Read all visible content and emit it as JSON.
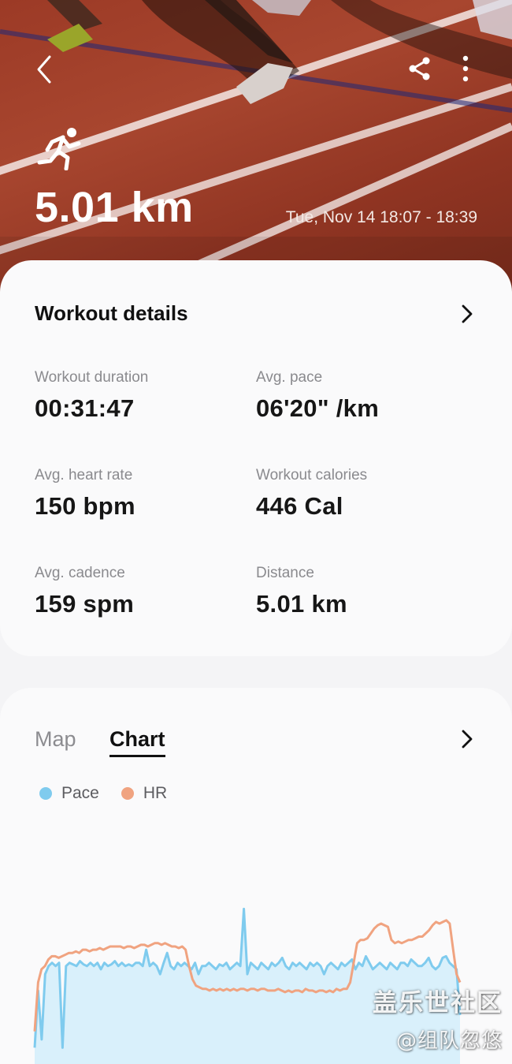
{
  "header": {
    "distance": "5.01 km",
    "datetime": "Tue, Nov 14 18:07 - 18:39"
  },
  "details": {
    "title": "Workout details",
    "metrics": [
      {
        "label": "Workout duration",
        "value": "00:31:47"
      },
      {
        "label": "Avg. pace",
        "value": "06'20\" /km"
      },
      {
        "label": "Avg. heart rate",
        "value": "150 bpm"
      },
      {
        "label": "Workout calories",
        "value": "446 Cal"
      },
      {
        "label": "Avg. cadence",
        "value": "159 spm"
      },
      {
        "label": "Distance",
        "value": "5.01 km"
      }
    ]
  },
  "chart_section": {
    "tabs": [
      "Map",
      "Chart"
    ],
    "active_tab": "Chart"
  },
  "icons": {
    "back": "back-arrow-icon",
    "share": "share-icon",
    "more": "more-vertical-icon",
    "activity": "running-icon",
    "chevron": "chevron-right-icon"
  },
  "colors": {
    "pace": "#7fcbee",
    "hr": "#f0a380",
    "pace_fill": "#d9f0fb"
  },
  "watermark": {
    "line1": "盖乐世社区",
    "line2": "@组队忽悠"
  },
  "chart_data": {
    "type": "line",
    "xlabel": "",
    "ylabel": "",
    "series": [
      {
        "name": "Pace",
        "values": [
          0.1,
          0.45,
          0.15,
          0.55,
          0.6,
          0.62,
          0.6,
          0.62,
          0.1,
          0.6,
          0.62,
          0.61,
          0.6,
          0.63,
          0.61,
          0.6,
          0.62,
          0.6,
          0.62,
          0.58,
          0.62,
          0.6,
          0.61,
          0.63,
          0.6,
          0.62,
          0.6,
          0.61,
          0.6,
          0.62,
          0.62,
          0.6,
          0.7,
          0.6,
          0.62,
          0.6,
          0.55,
          0.62,
          0.68,
          0.6,
          0.58,
          0.62,
          0.6,
          0.62,
          0.6,
          0.58,
          0.62,
          0.55,
          0.6,
          0.6,
          0.62,
          0.6,
          0.58,
          0.61,
          0.6,
          0.62,
          0.58,
          0.6,
          0.62,
          0.6,
          0.95,
          0.55,
          0.62,
          0.6,
          0.58,
          0.62,
          0.6,
          0.58,
          0.62,
          0.6,
          0.62,
          0.65,
          0.6,
          0.58,
          0.62,
          0.6,
          0.62,
          0.6,
          0.58,
          0.62,
          0.6,
          0.62,
          0.6,
          0.55,
          0.6,
          0.62,
          0.6,
          0.58,
          0.62,
          0.6,
          0.62,
          0.64,
          0.58,
          0.62,
          0.6,
          0.66,
          0.62,
          0.58,
          0.6,
          0.62,
          0.6,
          0.58,
          0.62,
          0.6,
          0.58,
          0.62,
          0.62,
          0.6,
          0.64,
          0.62,
          0.6,
          0.6,
          0.62,
          0.65,
          0.6,
          0.58,
          0.6,
          0.65,
          0.66,
          0.62,
          0.6,
          0.58,
          0.3
        ]
      },
      {
        "name": "HR",
        "values": [
          0.2,
          0.5,
          0.58,
          0.6,
          0.64,
          0.66,
          0.66,
          0.65,
          0.66,
          0.67,
          0.68,
          0.68,
          0.69,
          0.68,
          0.7,
          0.7,
          0.69,
          0.7,
          0.7,
          0.71,
          0.7,
          0.71,
          0.72,
          0.72,
          0.72,
          0.72,
          0.71,
          0.72,
          0.72,
          0.71,
          0.72,
          0.73,
          0.73,
          0.72,
          0.73,
          0.74,
          0.74,
          0.73,
          0.74,
          0.73,
          0.72,
          0.72,
          0.71,
          0.72,
          0.7,
          0.6,
          0.52,
          0.48,
          0.47,
          0.46,
          0.46,
          0.45,
          0.46,
          0.45,
          0.46,
          0.45,
          0.46,
          0.45,
          0.46,
          0.45,
          0.46,
          0.46,
          0.45,
          0.46,
          0.46,
          0.45,
          0.46,
          0.46,
          0.45,
          0.45,
          0.45,
          0.46,
          0.45,
          0.44,
          0.45,
          0.44,
          0.45,
          0.45,
          0.44,
          0.46,
          0.45,
          0.45,
          0.44,
          0.45,
          0.45,
          0.44,
          0.45,
          0.44,
          0.46,
          0.45,
          0.46,
          0.46,
          0.5,
          0.62,
          0.74,
          0.76,
          0.76,
          0.77,
          0.8,
          0.83,
          0.85,
          0.86,
          0.85,
          0.84,
          0.76,
          0.74,
          0.75,
          0.74,
          0.75,
          0.76,
          0.76,
          0.77,
          0.78,
          0.78,
          0.8,
          0.82,
          0.85,
          0.87,
          0.86,
          0.87,
          0.88,
          0.86,
          0.7,
          0.55,
          0.5
        ]
      }
    ]
  }
}
